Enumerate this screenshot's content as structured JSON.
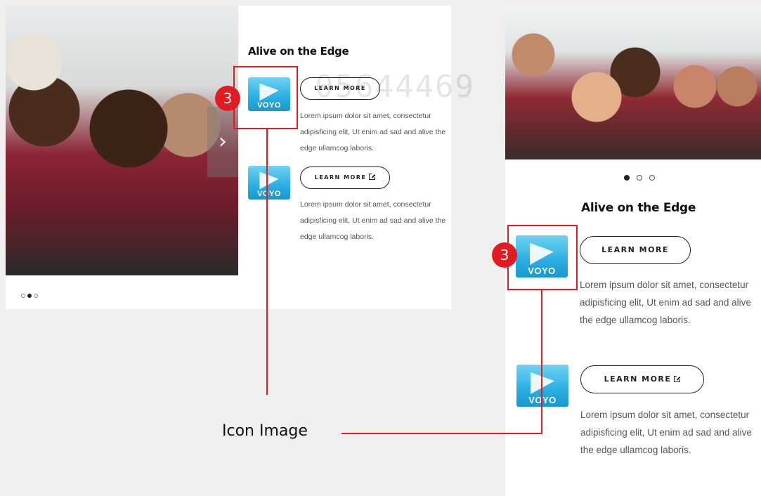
{
  "desktop": {
    "title": "Alive on the Edge",
    "next_arrow": "›",
    "carousel_dots": [
      {
        "active": false
      },
      {
        "active": true
      },
      {
        "active": false
      }
    ],
    "items": [
      {
        "icon_brand": "VOYO",
        "button_label": "LEARN MORE",
        "external": false,
        "text": "Lorem ipsum dolor sit amet, consectetur adipisficing elit, Ut enim ad sad and alive the edge ullamcog laboris."
      },
      {
        "icon_brand": "VOYO",
        "button_label": "LEARN MORE",
        "external": true,
        "text": "Lorem ipsum dolor sit amet, consectetur adipisficing elit, Ut enim ad sad and alive the edge ullamcog laboris."
      }
    ]
  },
  "mobile": {
    "title": "Alive on the Edge",
    "carousel_dots": [
      {
        "active": true
      },
      {
        "active": false
      },
      {
        "active": false
      }
    ],
    "items": [
      {
        "icon_brand": "VOYO",
        "button_label": "LEARN MORE",
        "external": false,
        "text": "Lorem ipsum dolor sit amet, consectetur adipisficing elit, Ut enim ad sad and alive the edge ullamcog laboris."
      },
      {
        "icon_brand": "VOYO",
        "button_label": "LEARN MORE",
        "external": true,
        "text": "Lorem ipsum dolor sit amet, consectetur adipisficing elit, Ut enim ad sad and alive the edge ullamcog laboris."
      }
    ]
  },
  "annotation": {
    "badge_number": "3",
    "callout_label": "Icon Image",
    "accent_color": "#e21b23"
  },
  "watermark": "05644469",
  "colors": {
    "voyo_blue": "#2aaee2",
    "highlight_red": "#e21b23",
    "background": "#efefef"
  }
}
